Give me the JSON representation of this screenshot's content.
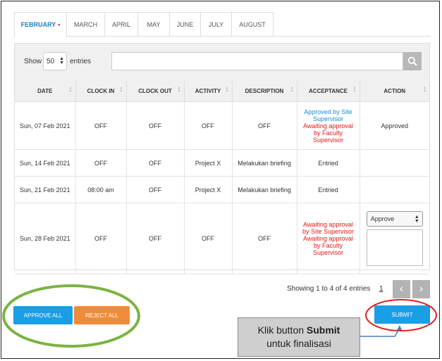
{
  "tabs": [
    {
      "label": "FEBRUARY",
      "active": true
    },
    {
      "label": "MARCH"
    },
    {
      "label": "APRIL"
    },
    {
      "label": "MAY"
    },
    {
      "label": "JUNE"
    },
    {
      "label": "JULY"
    },
    {
      "label": "AUGUST"
    }
  ],
  "active_dot": "•",
  "toolbar": {
    "show_label": "Show",
    "entries_value": "50",
    "entries_label": "entries",
    "search_placeholder": ""
  },
  "table": {
    "headers": [
      "DATE",
      "CLOCK IN",
      "CLOCK OUT",
      "ACTIVITY",
      "DESCRIPTION",
      "ACCEPTANCE",
      "ACTION"
    ],
    "rows": [
      {
        "date": "Sun, 07 Feb 2021",
        "clock_in": "OFF",
        "clock_out": "OFF",
        "activity": "OFF",
        "description": "OFF",
        "acceptance_blue": "Approved by Site Supervisor",
        "acceptance_red": "Awaiting approval by Faculty Supervisor",
        "action": "Approved"
      },
      {
        "date": "Sun, 14 Feb 2021",
        "clock_in": "OFF",
        "clock_out": "OFF",
        "activity": "Project X",
        "description": "Melakukan briefing",
        "acceptance": "Entried",
        "action": ""
      },
      {
        "date": "Sun, 21 Feb 2021",
        "clock_in": "08:00 am",
        "clock_out": "OFF",
        "activity": "Project X",
        "description": "Melakukan briefing",
        "acceptance": "Entried",
        "action": ""
      },
      {
        "date": "Sun, 28 Feb 2021",
        "clock_in": "OFF",
        "clock_out": "OFF",
        "activity": "OFF",
        "description": "OFF",
        "acceptance_red_1": "Awaiting approval by Site Supervisor",
        "acceptance_red_2": "Awaiting approval by Faculty Supervisor",
        "action_select": "Approve"
      }
    ]
  },
  "pagination": {
    "info": "Showing 1 to 4 of 4 entries",
    "page": "1",
    "prev": "‹",
    "next": "›"
  },
  "buttons": {
    "approve_all": "APPROVE ALL",
    "reject_all": "REJECT ALL",
    "submit": "SUBMIT"
  },
  "callout": {
    "line1_prefix": "Klik button ",
    "line1_bold": "Submit",
    "line2": "untuk finalisasi"
  },
  "colors": {
    "primary": "#1a9ee6",
    "reject": "#ef8c3a",
    "annotation_green": "#7cb342",
    "annotation_red": "#e02020"
  }
}
